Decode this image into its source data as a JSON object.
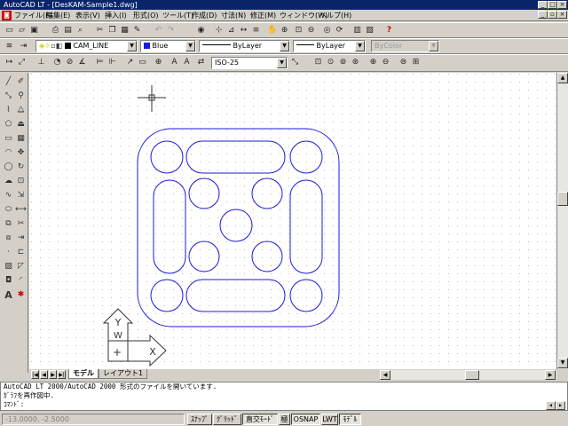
{
  "window": {
    "title": "AutoCAD LT - [DesKAM-Sample1.dwg]"
  },
  "menu": [
    "ファイル(F)",
    "編集(E)",
    "表示(V)",
    "挿入(I)",
    "形式(O)",
    "ツール(T)",
    "作成(D)",
    "寸法(N)",
    "修正(M)",
    "ウィンドウ(W)",
    "ヘルプ(H)"
  ],
  "properties": {
    "layer": "CAM_LINE",
    "color": "Blue",
    "linetype": "ByLayer",
    "lineweight": "ByLayer",
    "plotstyle": "ByColor"
  },
  "dimstyle": "ISO-25",
  "tabs": {
    "model": "モデル",
    "layout": "レイアウト1"
  },
  "ucs": {
    "y_label": "Y",
    "w_label": "W",
    "x_label": "X"
  },
  "command": {
    "lines": [
      "AutoCAD LT 2000/AutoCAD 2000 形式のファイルを開いています.",
      "ｶﾞﾗﾌを再作図中.",
      "ｺﾏﾝﾄﾞ:"
    ]
  },
  "status": {
    "coords": "-13.0000, -2.5000",
    "buttons": [
      "ｽﾅｯﾌﾟ",
      "ｸﾞﾘｯﾄﾞ",
      "直交ﾓｰﾄﾞ",
      "極",
      "OSNAP",
      "LWT",
      "ﾓﾃﾞﾙ"
    ]
  },
  "colors": {
    "titlebar": "#0a246a",
    "entity": "#1a1adc",
    "grid": "#b8b8b8"
  }
}
